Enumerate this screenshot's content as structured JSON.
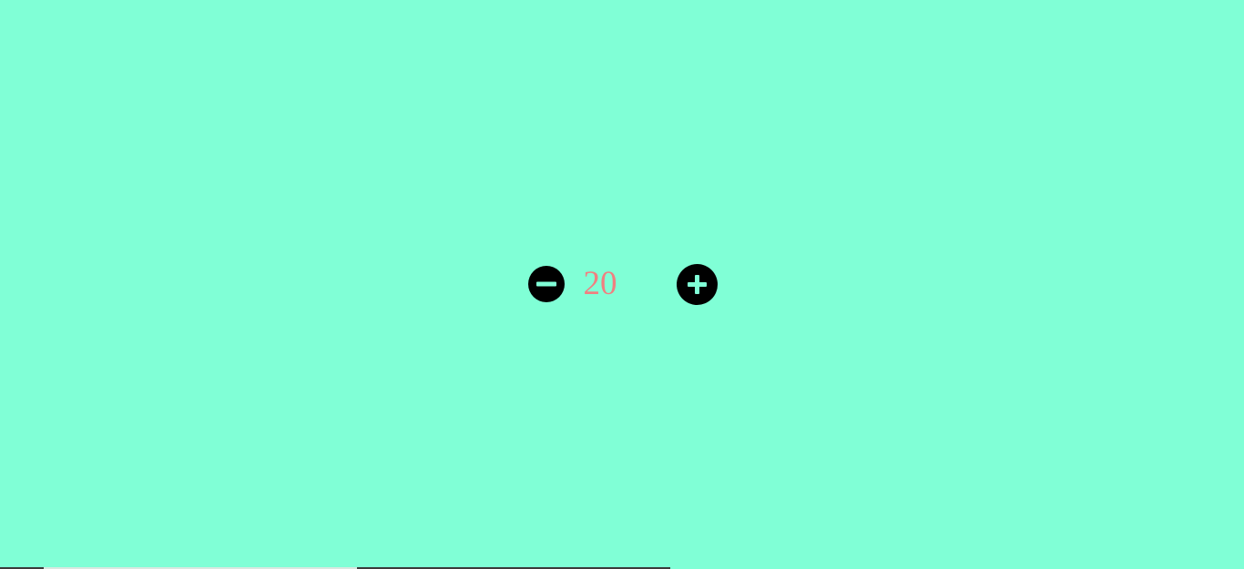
{
  "counter": {
    "value": "20",
    "decrement_icon": "minus-circle-icon",
    "increment_icon": "plus-circle-icon"
  },
  "colors": {
    "background": "#80FFD6",
    "value_text": "#F08080",
    "button_fill": "#000000",
    "button_glyph": "#80FFD6"
  }
}
